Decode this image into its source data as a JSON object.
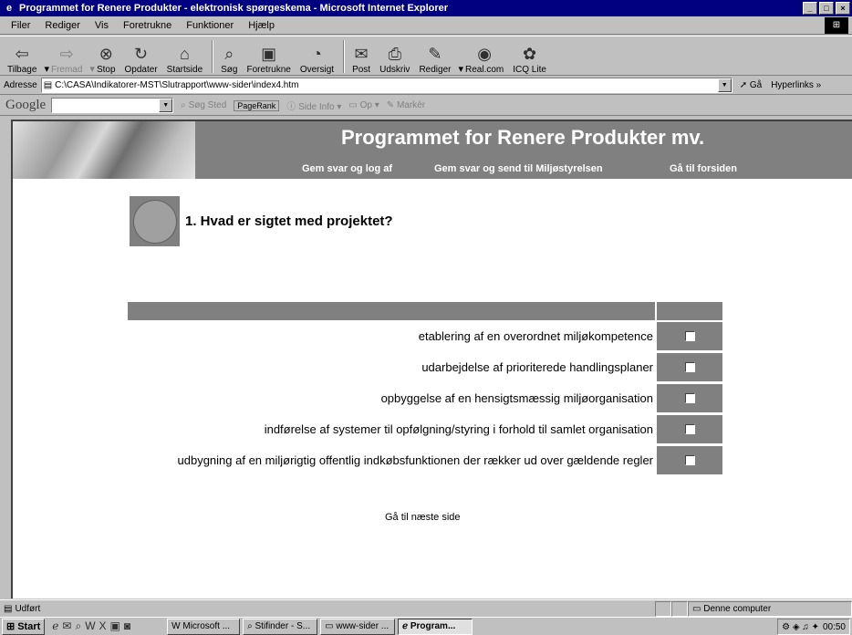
{
  "window": {
    "title": "Programmet for Renere Produkter - elektronisk spørgeskema - Microsoft Internet Explorer",
    "min": "_",
    "max": "□",
    "close": "×"
  },
  "menu": [
    "Filer",
    "Rediger",
    "Vis",
    "Foretrukne",
    "Funktioner",
    "Hjælp"
  ],
  "toolbar": {
    "back": "Tilbage",
    "forward": "Fremad",
    "stop": "Stop",
    "refresh": "Opdater",
    "home": "Startside",
    "search": "Søg",
    "favorites": "Foretrukne",
    "history": "Oversigt",
    "mail": "Post",
    "print": "Udskriv",
    "edit": "Rediger",
    "realcom": "Real.com",
    "icq": "ICQ Lite"
  },
  "address": {
    "label": "Adresse",
    "value": "C:\\CASA\\Indikatorer-MST\\Slutrapport\\www-sider\\index4.htm",
    "go": "Gå",
    "links": "Hyperlinks »"
  },
  "google": {
    "logo": "Google",
    "search_site": "Søg Sted",
    "pagerank": "PageRank",
    "page_info": "Side Info",
    "up": "Op",
    "highlight": "Markér"
  },
  "page": {
    "title": "Programmet for Renere Produkter mv.",
    "nav": [
      "Gem svar og log af",
      "Gem svar og send til Miljøstyrelsen",
      "Gå til forsiden"
    ],
    "question": "1. Hvad er sigtet med projektet?",
    "options": [
      "etablering af en overordnet miljøkompetence",
      "udarbejdelse af prioriterede handlingsplaner",
      "opbyggelse af en hensigtsmæssig miljøorganisation",
      "indførelse af systemer til opfølgning/styring i forhold til samlet organisation",
      "udbygning af en miljørigtig offentlig indkøbsfunktionen der rækker ud over gældende regler"
    ],
    "next": "Gå til næste side"
  },
  "status": {
    "text": "Udført",
    "zone": "Denne computer"
  },
  "taskbar": {
    "start": "Start",
    "tasks": [
      "Microsoft ...",
      "Stifinder - S...",
      "www-sider ...",
      "Program..."
    ],
    "clock": "00:50"
  }
}
